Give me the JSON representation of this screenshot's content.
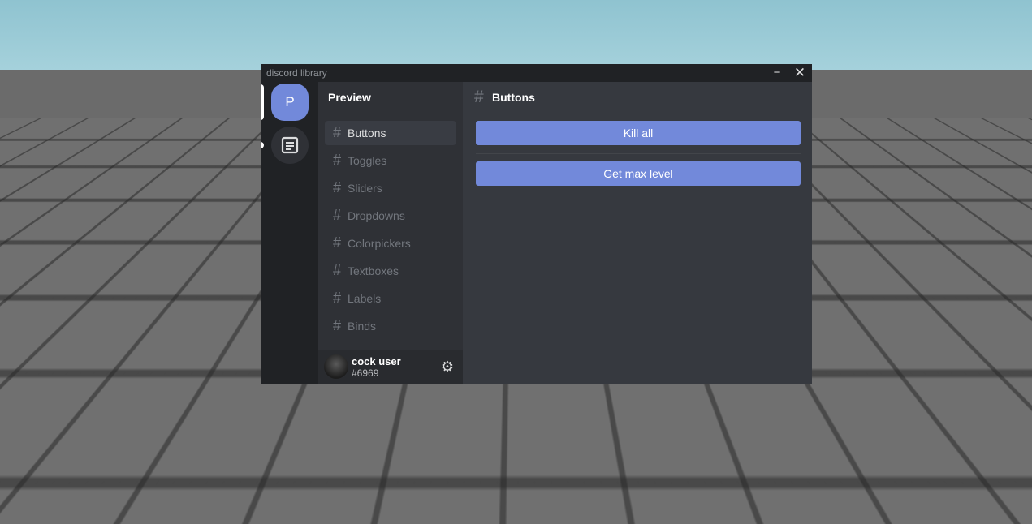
{
  "window": {
    "title": "discord library",
    "minimize_glyph": "−",
    "close_glyph": "✕"
  },
  "servers": [
    {
      "label": "P",
      "icon": "server-initial"
    },
    {
      "label": "",
      "icon": "document-icon"
    }
  ],
  "guild": {
    "name": "Preview"
  },
  "channels": [
    {
      "hash": "#",
      "label": "Buttons",
      "active": true
    },
    {
      "hash": "#",
      "label": "Toggles",
      "active": false
    },
    {
      "hash": "#",
      "label": "Sliders",
      "active": false
    },
    {
      "hash": "#",
      "label": "Dropdowns",
      "active": false
    },
    {
      "hash": "#",
      "label": "Colorpickers",
      "active": false
    },
    {
      "hash": "#",
      "label": "Textboxes",
      "active": false
    },
    {
      "hash": "#",
      "label": "Labels",
      "active": false
    },
    {
      "hash": "#",
      "label": "Binds",
      "active": false
    }
  ],
  "user": {
    "name": "cock user",
    "tag": "#6969",
    "settings_icon": "gear-icon",
    "settings_glyph": "⚙"
  },
  "content": {
    "hash": "#",
    "title": "Buttons",
    "buttons": [
      {
        "label": "Kill all"
      },
      {
        "label": "Get max level"
      }
    ]
  },
  "colors": {
    "accent": "#7289da",
    "rail": "#202225",
    "channels_bg": "#2f3136",
    "content_bg": "#36393f",
    "user_panel_bg": "#292b2f"
  }
}
